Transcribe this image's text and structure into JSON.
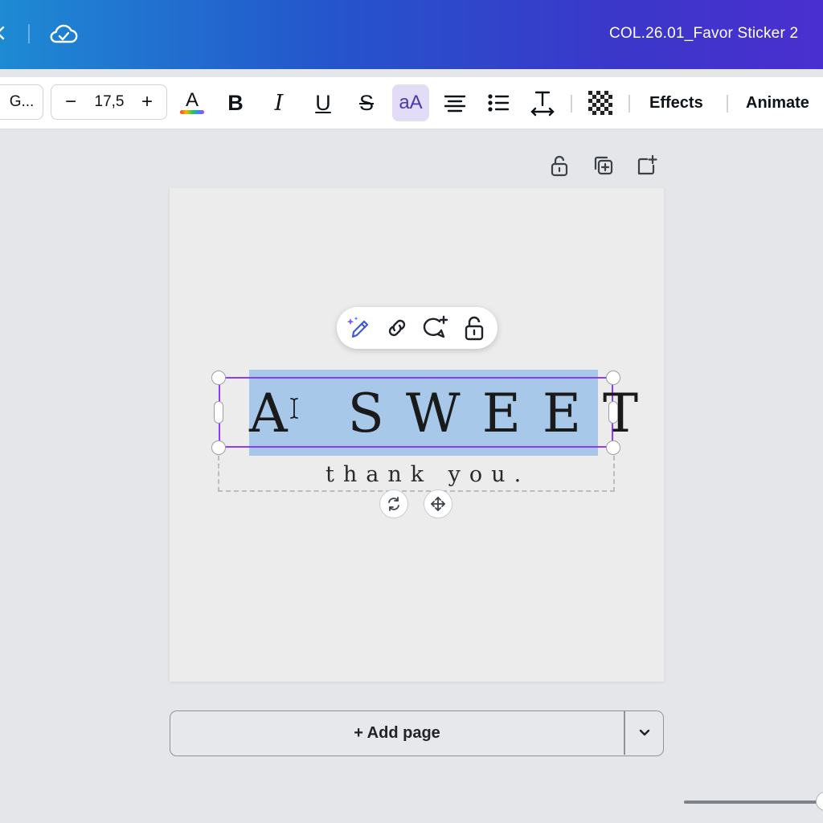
{
  "header": {
    "document_title": "COL.26.01_Favor Sticker 2",
    "gradient_colors": [
      "#1e8ad3",
      "#2455cc",
      "#4a2fd0"
    ]
  },
  "toolbar": {
    "font_name": "G...",
    "font_size": "17,5",
    "decrease_label": "−",
    "increase_label": "+",
    "bold_label": "B",
    "italic_label": "I",
    "underline_label": "U",
    "strike_label": "S",
    "case_label": "aA",
    "effects_label": "Effects",
    "animate_label": "Animate",
    "active_color": "#e2dcf7",
    "icons": [
      "text-color-icon",
      "align-center-icon",
      "bullet-list-icon",
      "letter-spacing-icon",
      "transparency-icon"
    ]
  },
  "page_actions": {
    "icons": [
      "unlock-icon",
      "duplicate-page-icon",
      "add-page-icon"
    ]
  },
  "context_toolbar": {
    "icons": [
      "magic-edit-icon",
      "link-icon",
      "comment-add-icon",
      "unlock-icon"
    ]
  },
  "canvas": {
    "headline": "A SWEET",
    "subtitle": "thank you.",
    "selection_color": "#8b3dff",
    "highlight_color": "#a8c8ea",
    "controls": [
      "rotate-icon",
      "move-icon"
    ]
  },
  "add_page": {
    "label": "+ Add page"
  },
  "zoom": {
    "level_fraction": 0.98
  }
}
